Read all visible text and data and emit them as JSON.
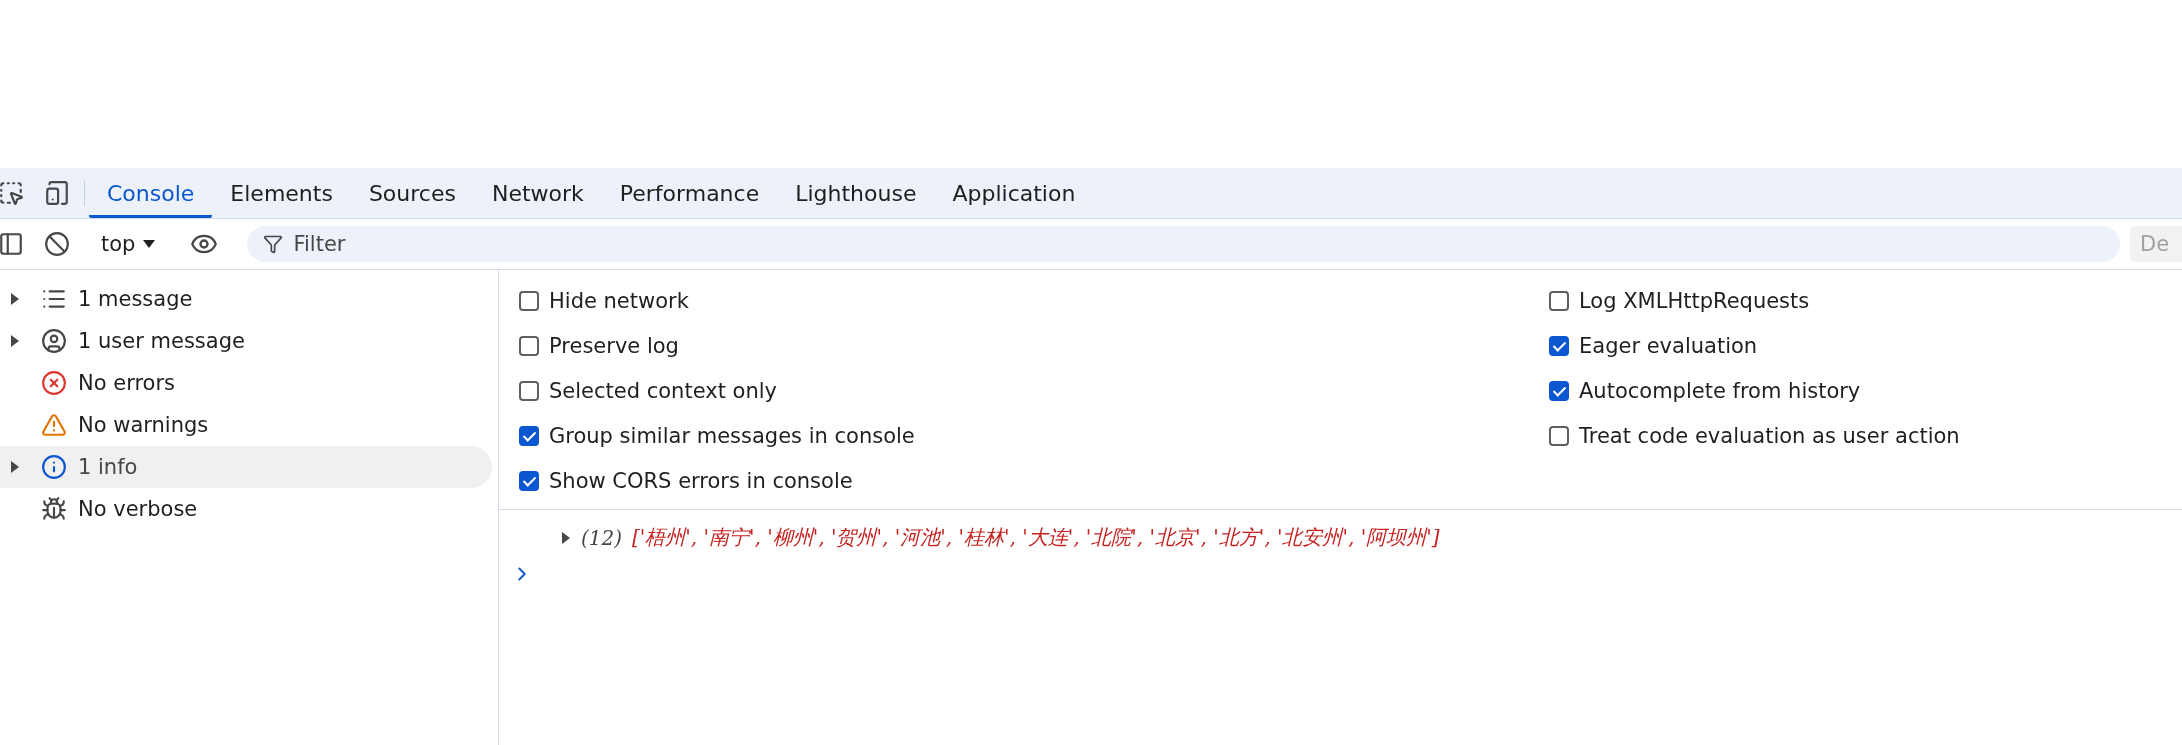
{
  "tabs": [
    {
      "label": "Console",
      "selected": true
    },
    {
      "label": "Elements",
      "selected": false
    },
    {
      "label": "Sources",
      "selected": false
    },
    {
      "label": "Network",
      "selected": false
    },
    {
      "label": "Performance",
      "selected": false
    },
    {
      "label": "Lighthouse",
      "selected": false
    },
    {
      "label": "Application",
      "selected": false
    }
  ],
  "context_selector": {
    "label": "top"
  },
  "filter": {
    "placeholder": "Filter"
  },
  "cut_button": {
    "label": "De"
  },
  "sidebar": {
    "items": [
      {
        "label": "1 message",
        "kind": "messages",
        "expandable": true,
        "selected": false
      },
      {
        "label": "1 user message",
        "kind": "user",
        "expandable": true,
        "selected": false
      },
      {
        "label": "No errors",
        "kind": "errors",
        "expandable": false,
        "selected": false
      },
      {
        "label": "No warnings",
        "kind": "warnings",
        "expandable": false,
        "selected": false
      },
      {
        "label": "1 info",
        "kind": "info",
        "expandable": true,
        "selected": true
      },
      {
        "label": "No verbose",
        "kind": "verbose",
        "expandable": false,
        "selected": false
      }
    ]
  },
  "settings": {
    "left": [
      {
        "label": "Hide network",
        "checked": false
      },
      {
        "label": "Preserve log",
        "checked": false
      },
      {
        "label": "Selected context only",
        "checked": false
      },
      {
        "label": "Group similar messages in console",
        "checked": true
      },
      {
        "label": "Show CORS errors in console",
        "checked": true
      }
    ],
    "right": [
      {
        "label": "Log XMLHttpRequests",
        "checked": false
      },
      {
        "label": "Eager evaluation",
        "checked": true
      },
      {
        "label": "Autocomplete from history",
        "checked": true
      },
      {
        "label": "Treat code evaluation as user action",
        "checked": false
      }
    ]
  },
  "console": {
    "entries": [
      {
        "count": "(12)",
        "value": "['梧州', '南宁', '柳州', '贺州', '河池', '桂林', '大连', '北院', '北京', '北方', '北安州', '阿坝州']",
        "expanded": false
      }
    ]
  }
}
